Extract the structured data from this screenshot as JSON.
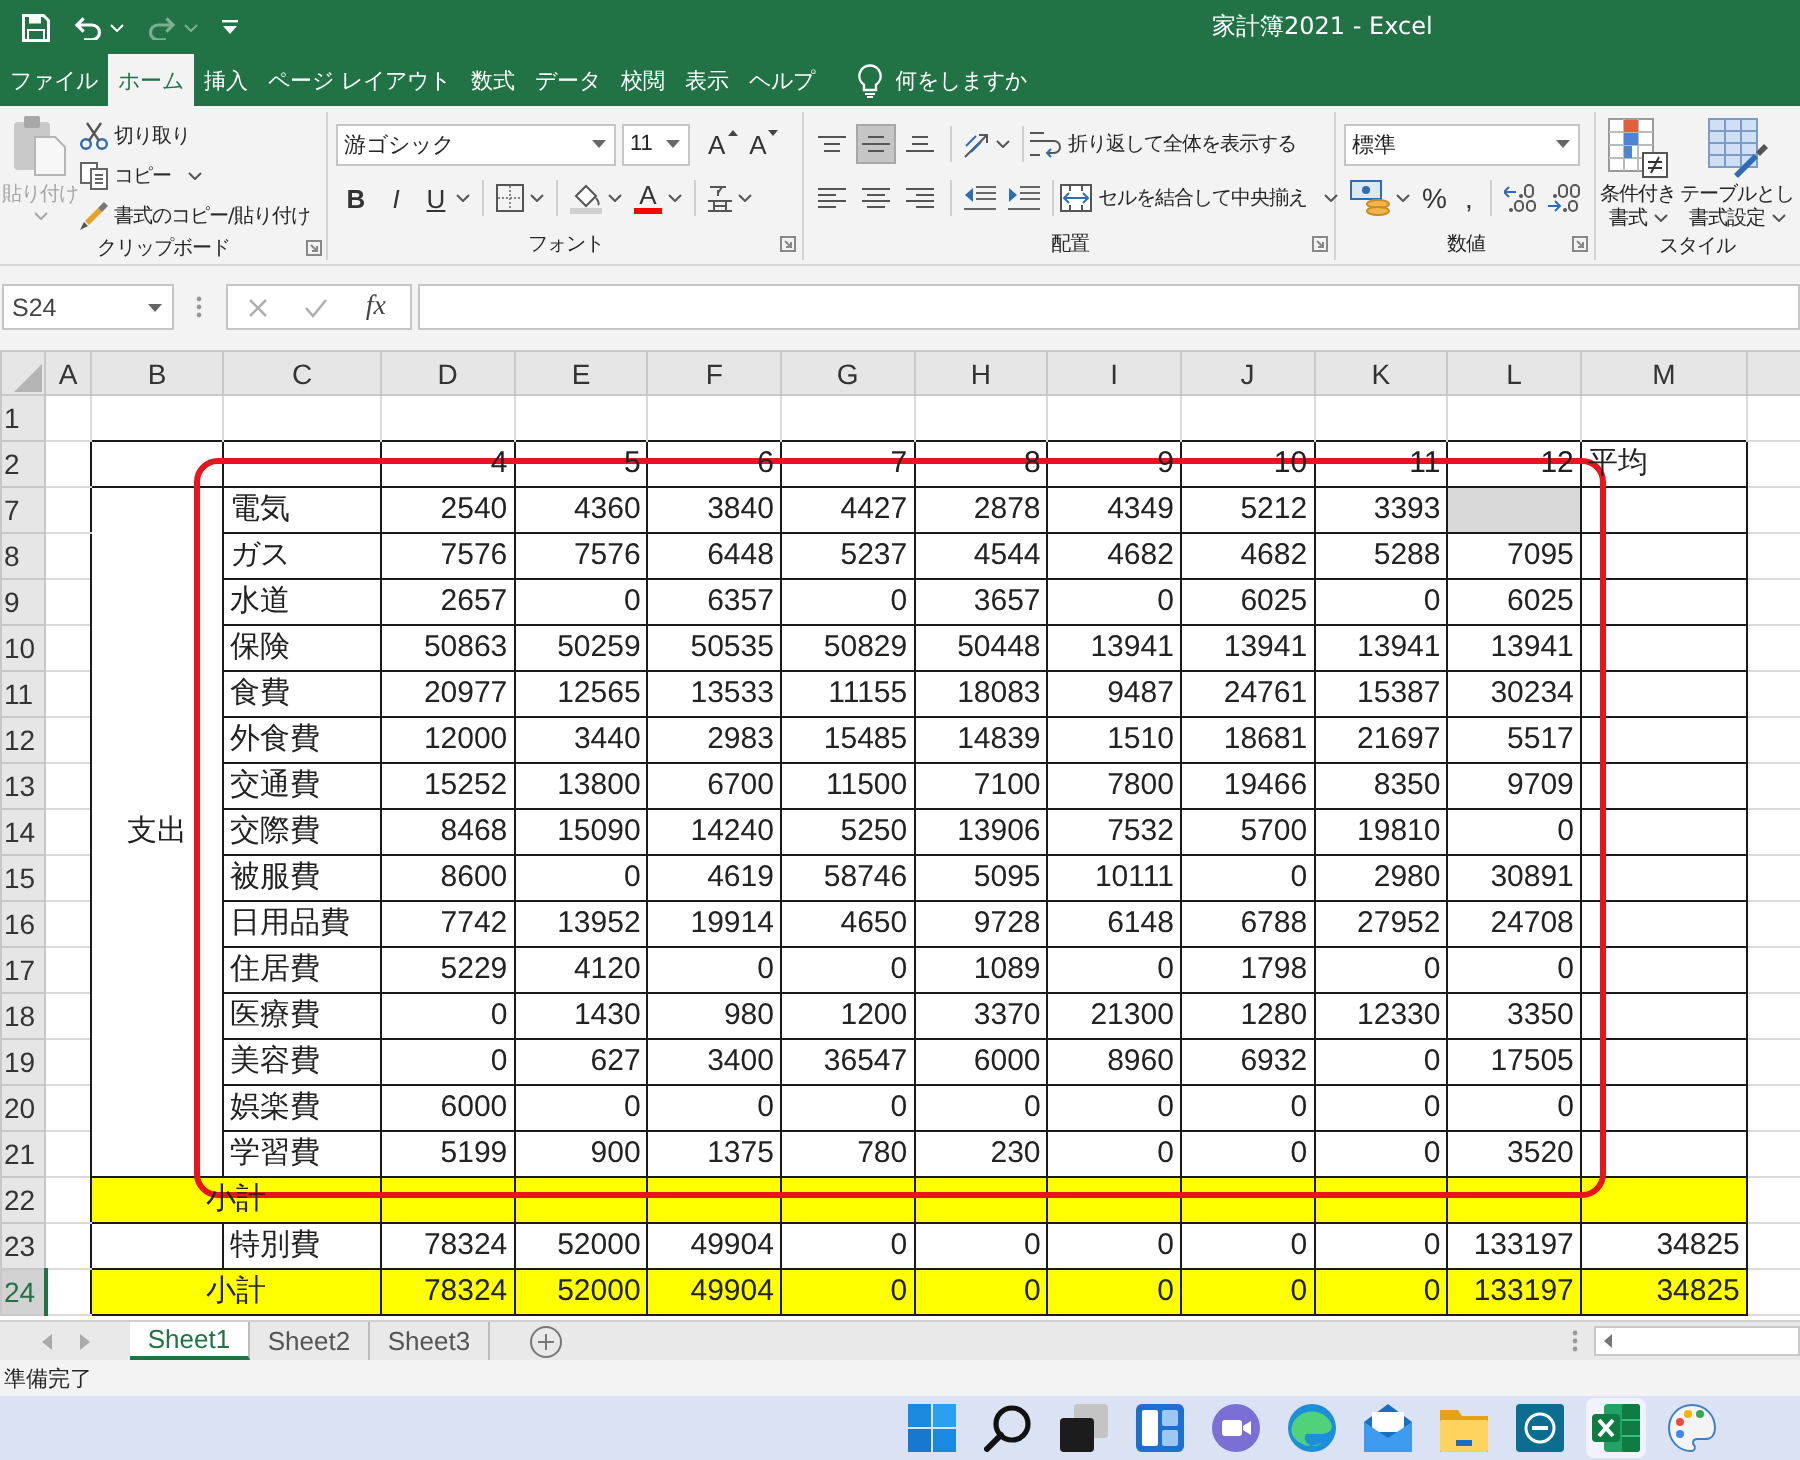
{
  "window": {
    "title": "家計簿2021 - Excel"
  },
  "quick_access": [
    {
      "kind": "save",
      "disabled": false
    },
    {
      "kind": "undo",
      "disabled": false
    },
    {
      "kind": "redo",
      "disabled": true
    },
    {
      "kind": "customize",
      "disabled": false
    }
  ],
  "ribbon_tabs": [
    {
      "label": "ファイル",
      "selected": false
    },
    {
      "label": "ホーム",
      "selected": true
    },
    {
      "label": "挿入",
      "selected": false
    },
    {
      "label": "ページ レイアウト",
      "selected": false
    },
    {
      "label": "数式",
      "selected": false
    },
    {
      "label": "データ",
      "selected": false
    },
    {
      "label": "校閲",
      "selected": false
    },
    {
      "label": "表示",
      "selected": false
    },
    {
      "label": "ヘルプ",
      "selected": false
    }
  ],
  "tell_me": {
    "placeholder": "何をしますか"
  },
  "ribbon": {
    "clipboard": {
      "label": "クリップボード",
      "paste": {
        "label": "貼り付け",
        "disabled": true
      },
      "commands": [
        {
          "kind": "cut",
          "label": "切り取り",
          "dropdown": false
        },
        {
          "kind": "copy",
          "label": "コピー",
          "dropdown": true
        },
        {
          "kind": "format_painter",
          "label": "書式のコピー/貼り付け",
          "dropdown": false
        }
      ]
    },
    "font": {
      "label": "フォント",
      "font_name": "游ゴシック",
      "font_size": "11",
      "buttons": [
        {
          "kind": "grow_font",
          "glyph": "A"
        },
        {
          "kind": "shrink_font",
          "glyph": "A"
        },
        {
          "kind": "bold",
          "glyph": "B"
        },
        {
          "kind": "italic",
          "glyph": "I"
        },
        {
          "kind": "underline",
          "glyph": "U",
          "dropdown": true
        },
        {
          "kind": "borders",
          "dropdown": true
        },
        {
          "kind": "fill_color",
          "dropdown": true
        },
        {
          "kind": "font_color",
          "glyph": "A",
          "color": "#ff0000",
          "dropdown": true
        },
        {
          "kind": "phonetic",
          "dropdown": true
        }
      ]
    },
    "alignment": {
      "label": "配置",
      "vertical": [
        {
          "kind": "top",
          "selected": false
        },
        {
          "kind": "middle",
          "selected": true
        },
        {
          "kind": "bottom",
          "selected": false
        }
      ],
      "horizontal": [
        {
          "kind": "left",
          "selected": false
        },
        {
          "kind": "center",
          "selected": false
        },
        {
          "kind": "right",
          "selected": false
        }
      ],
      "wrap_text": "折り返して全体を表示する",
      "merge_center": "セルを結合して中央揃え"
    },
    "number": {
      "label": "数値",
      "format": "標準",
      "buttons": [
        {
          "kind": "accounting",
          "dropdown": true
        },
        {
          "kind": "percent",
          "glyph": "%"
        },
        {
          "kind": "comma",
          "glyph": ","
        },
        {
          "kind": "increase_decimal"
        },
        {
          "kind": "decrease_decimal"
        }
      ]
    },
    "styles": {
      "label": "スタイル",
      "commands": [
        {
          "kind": "conditional",
          "lines": [
            "条件付き",
            "書式"
          ]
        },
        {
          "kind": "table",
          "lines": [
            "テーブルとし",
            "書式設定"
          ]
        }
      ]
    }
  },
  "formula_bar": {
    "name_box": "S24",
    "edit_buttons": [
      {
        "kind": "cancel",
        "disabled": true
      },
      {
        "kind": "enter",
        "disabled": true
      }
    ],
    "function_button": "fx"
  },
  "columns": [
    "A",
    "B",
    "C",
    "D",
    "E",
    "F",
    "G",
    "H",
    "I",
    "J",
    "K",
    "L",
    "M"
  ],
  "rows": [
    {
      "number": "1",
      "kind": "blank",
      "selected": false
    },
    {
      "number": "2",
      "kind": "months",
      "selected": false,
      "values": [
        "4",
        "5",
        "6",
        "7",
        "8",
        "9",
        "10",
        "11",
        "12"
      ],
      "average": "平均"
    },
    {
      "kind": "group",
      "label": "支出",
      "rows": [
        {
          "number": "7",
          "selected": false,
          "category": "電気",
          "values": [
            "2540",
            "4360",
            "3840",
            "4427",
            "2878",
            "4349",
            "5212",
            "3393",
            {
              "shaded": true
            }
          ]
        },
        {
          "number": "8",
          "selected": false,
          "category": "ガス",
          "values": [
            "7576",
            "7576",
            "6448",
            "5237",
            "4544",
            "4682",
            "4682",
            "5288",
            "7095"
          ]
        },
        {
          "number": "9",
          "selected": false,
          "category": "水道",
          "values": [
            "2657",
            "0",
            "6357",
            "0",
            "3657",
            "0",
            "6025",
            "0",
            "6025"
          ]
        },
        {
          "number": "10",
          "selected": false,
          "category": "保険",
          "values": [
            "50863",
            "50259",
            "50535",
            "50829",
            "50448",
            "13941",
            "13941",
            "13941",
            "13941"
          ]
        },
        {
          "number": "11",
          "selected": false,
          "category": "食費",
          "values": [
            "20977",
            "12565",
            "13533",
            "11155",
            "18083",
            "9487",
            "24761",
            "15387",
            "30234"
          ]
        },
        {
          "number": "12",
          "selected": false,
          "category": "外食費",
          "values": [
            "12000",
            "3440",
            "2983",
            "15485",
            "14839",
            "1510",
            "18681",
            "21697",
            "5517"
          ]
        },
        {
          "number": "13",
          "selected": false,
          "category": "交通費",
          "values": [
            "15252",
            "13800",
            "6700",
            "11500",
            "7100",
            "7800",
            "19466",
            "8350",
            "9709"
          ]
        },
        {
          "number": "14",
          "selected": false,
          "category": "交際費",
          "values": [
            "8468",
            "15090",
            "14240",
            "5250",
            "13906",
            "7532",
            "5700",
            "19810",
            "0"
          ]
        },
        {
          "number": "15",
          "selected": false,
          "category": "被服費",
          "values": [
            "8600",
            "0",
            "4619",
            "58746",
            "5095",
            "10111",
            "0",
            "2980",
            "30891"
          ]
        },
        {
          "number": "16",
          "selected": false,
          "category": "日用品費",
          "values": [
            "7742",
            "13952",
            "19914",
            "4650",
            "9728",
            "6148",
            "6788",
            "27952",
            "24708"
          ]
        },
        {
          "number": "17",
          "selected": false,
          "category": "住居費",
          "values": [
            "5229",
            "4120",
            "0",
            "0",
            "1089",
            "0",
            "1798",
            "0",
            "0"
          ]
        },
        {
          "number": "18",
          "selected": false,
          "category": "医療費",
          "values": [
            "0",
            "1430",
            "980",
            "1200",
            "3370",
            "21300",
            "1280",
            "12330",
            "3350"
          ]
        },
        {
          "number": "19",
          "selected": false,
          "category": "美容費",
          "values": [
            "0",
            "627",
            "3400",
            "36547",
            "6000",
            "8960",
            "6932",
            "0",
            "17505"
          ]
        },
        {
          "number": "20",
          "selected": false,
          "category": "娯楽費",
          "values": [
            "6000",
            "0",
            "0",
            "0",
            "0",
            "0",
            "0",
            "0",
            "0"
          ]
        },
        {
          "number": "21",
          "selected": false,
          "category": "学習費",
          "values": [
            "5199",
            "900",
            "1375",
            "780",
            "230",
            "0",
            "0",
            "0",
            "3520"
          ]
        }
      ]
    },
    {
      "number": "22",
      "kind": "subtotal",
      "selected": false,
      "label": "小計"
    },
    {
      "number": "23",
      "kind": "item",
      "selected": false,
      "category": "特別費",
      "values": [
        "78324",
        "52000",
        "49904",
        "0",
        "0",
        "0",
        "0",
        "0",
        "133197"
      ],
      "average": "34825"
    },
    {
      "number": "24",
      "kind": "subtotal",
      "selected": true,
      "label": "小計",
      "values": [
        "78324",
        "52000",
        "49904",
        "0",
        "0",
        "0",
        "0",
        "0",
        "133197"
      ],
      "average": "34825"
    }
  ],
  "sheet_tabs": [
    {
      "label": "Sheet1",
      "selected": true
    },
    {
      "label": "Sheet2",
      "selected": false
    },
    {
      "label": "Sheet3",
      "selected": false
    }
  ],
  "status_bar": {
    "text": "準備完了"
  },
  "taskbar": [
    {
      "kind": "start",
      "active": false
    },
    {
      "kind": "search",
      "active": false
    },
    {
      "kind": "task_view",
      "active": false
    },
    {
      "kind": "widgets",
      "active": false
    },
    {
      "kind": "chat",
      "active": false
    },
    {
      "kind": "browser",
      "active": false
    },
    {
      "kind": "mail",
      "active": false
    },
    {
      "kind": "files",
      "active": false
    },
    {
      "kind": "app",
      "active": false
    },
    {
      "kind": "spreadsheet",
      "active": true
    },
    {
      "kind": "paint",
      "active": false
    }
  ]
}
